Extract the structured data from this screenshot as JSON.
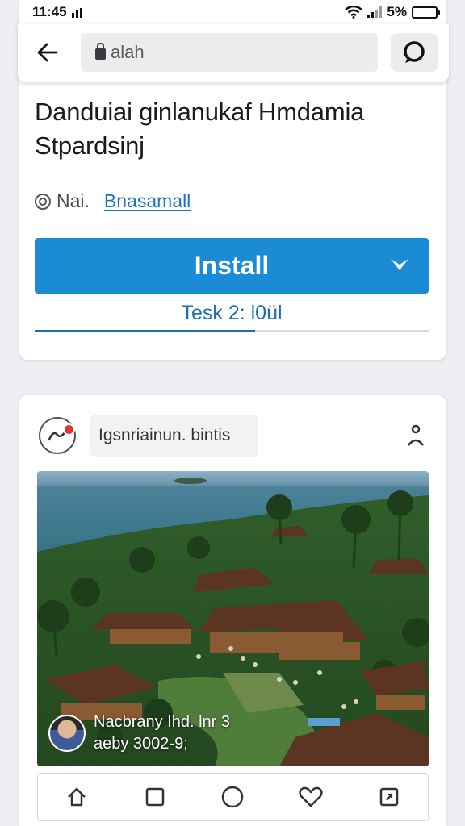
{
  "status_bar": {
    "time": "11:45",
    "battery": "5%"
  },
  "browser": {
    "url_text": "alah"
  },
  "article": {
    "title": "Danduiai ginlanukaf Hmdamia Stpardsinj",
    "meta_prefix": "Nai.",
    "meta_link": "Bnasamall",
    "install_label": "Install",
    "progress_text": "Tesk 2: l0ül",
    "progress": 0.56
  },
  "post": {
    "username": "Igsnriainun. bintis",
    "caption_line1": "Nacbrany Ihd. lnr 3",
    "caption_line2": "aeby 3002-9;",
    "image_content": "aerial view of a tropical village with brown-roofed wooden houses, palm trees, crowds of people and the sea with a small island"
  },
  "icons": {
    "back": "arrow-left-icon",
    "lock": "lock-icon",
    "action": "chat-icon",
    "install_chevron": "chevron-down-icon",
    "post_avatar": "profile-icon",
    "person": "person-icon",
    "nav": [
      "home-icon",
      "square-icon",
      "circle-icon",
      "heart-icon",
      "share-icon"
    ]
  },
  "colors": {
    "accent": "#1a8bd4",
    "link": "#1a73c4",
    "notification": "#e0352b"
  }
}
